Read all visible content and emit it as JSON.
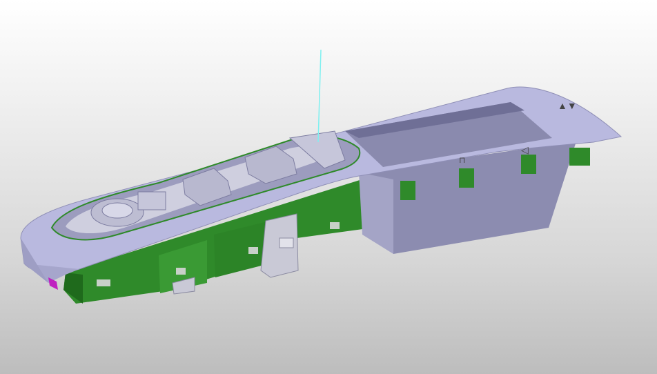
{
  "viewport": {
    "background_top": "#ffffff",
    "background_bottom": "#bdbdbd"
  },
  "part": {
    "bezel_color": "#b9b9df",
    "bezel_shadow_color": "#8f8fb6",
    "housing_color": "#2f8a2a",
    "housing_dark_color": "#1f6a1c",
    "pocket_color": "#8c8cb0",
    "connector_color": "#c9c9d6",
    "marker_color": "#c020c0",
    "axis_color": "#7ff0f0",
    "embossed_marks": [
      "▲▼",
      "◁",
      "⊓"
    ]
  }
}
